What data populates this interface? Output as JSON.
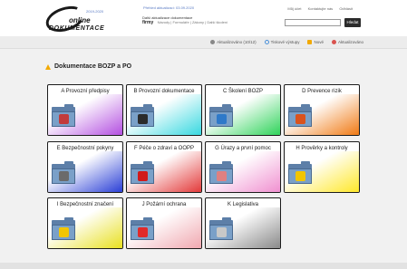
{
  "header": {
    "logo_year": "2019-2020",
    "logo_online": "online",
    "logo_dokumentace": "DOKUMENTACE",
    "top_link": "Přehled aktualizací: 03.09.2020",
    "updates_line": "Další aktualizace dokumentace",
    "firm_label": "firmy",
    "firm_sub": "Návody | Formuláře | Zákony | Další školení",
    "user_links": [
      "Můj účet",
      "Kontaktujte nás",
      "Odhlásit"
    ],
    "search_placeholder": "",
    "search_button": "Hledat"
  },
  "toolbar": {
    "items": [
      {
        "label": "Aktualizováno (10/12)",
        "icon": "eye-icon",
        "color": "#888888"
      },
      {
        "label": "Tiskové výstupy",
        "icon": "refresh-icon",
        "color": "#4a90d9"
      },
      {
        "label": "Nové",
        "icon": "star-icon",
        "color": "#f2a900"
      },
      {
        "label": "Aktualizováno",
        "icon": "update-icon",
        "color": "#d9534f"
      }
    ]
  },
  "section": {
    "title": "Dokumentace BOZP a PO"
  },
  "tiles": [
    {
      "label": "A Provozní předpisy",
      "gradient": "#b34fe0",
      "emblem": "#c23b3b"
    },
    {
      "label": "B Provozní dokumentace",
      "gradient": "#38d8e0",
      "emblem": "#2b2b2b"
    },
    {
      "label": "C Školení BOZP",
      "gradient": "#2fd35a",
      "emblem": "#2e79c9"
    },
    {
      "label": "D Prevence rizik",
      "gradient": "#f07a14",
      "emblem": "#d9531e"
    },
    {
      "label": "E Bezpečnostní pokyny",
      "gradient": "#2a3fd6",
      "emblem": "#6b6b6b"
    },
    {
      "label": "F Péče o zdraví a OOPP",
      "gradient": "#e33a3a",
      "emblem": "#d11a1a"
    },
    {
      "label": "G Úrazy a první pomoc",
      "gradient": "#f090d0",
      "emblem": "#e08080"
    },
    {
      "label": "H Prověrky a kontroly",
      "gradient": "#ffe82a",
      "emblem": "#f2c500"
    },
    {
      "label": "I Bezpečnostní značení",
      "gradient": "#e8e020",
      "emblem": "#f2c500"
    },
    {
      "label": "J Požární ochrana",
      "gradient": "#f0a8b0",
      "emblem": "#e12a2a"
    },
    {
      "label": "K Legislativa",
      "gradient": "#8a8a8a",
      "emblem": "#c8c8c8"
    }
  ]
}
